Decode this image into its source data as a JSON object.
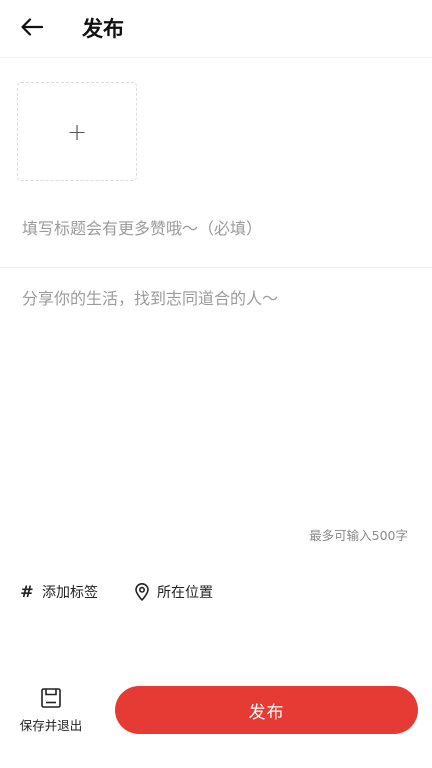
{
  "header": {
    "back_icon": "arrow-left-icon",
    "title": "发布"
  },
  "upload": {
    "icon": "plus-icon",
    "glyph": "+"
  },
  "title_field": {
    "placeholder": "填写标题会有更多赞哦～（必填）",
    "value": ""
  },
  "content_field": {
    "placeholder": "分享你的生活，找到志同道合的人～",
    "value": "",
    "limit_text": "最多可输入500字"
  },
  "options": {
    "tag": {
      "icon": "hashtag-icon",
      "glyph": "#",
      "label": "添加标签"
    },
    "location": {
      "icon": "location-pin-icon",
      "label": "所在位置"
    }
  },
  "bottom": {
    "save_icon": "save-draft-icon",
    "save_label": "保存并退出",
    "publish_label": "发布"
  },
  "colors": {
    "accent": "#e63b35",
    "placeholder": "#9b9b9b",
    "divider": "#eeeeee"
  }
}
